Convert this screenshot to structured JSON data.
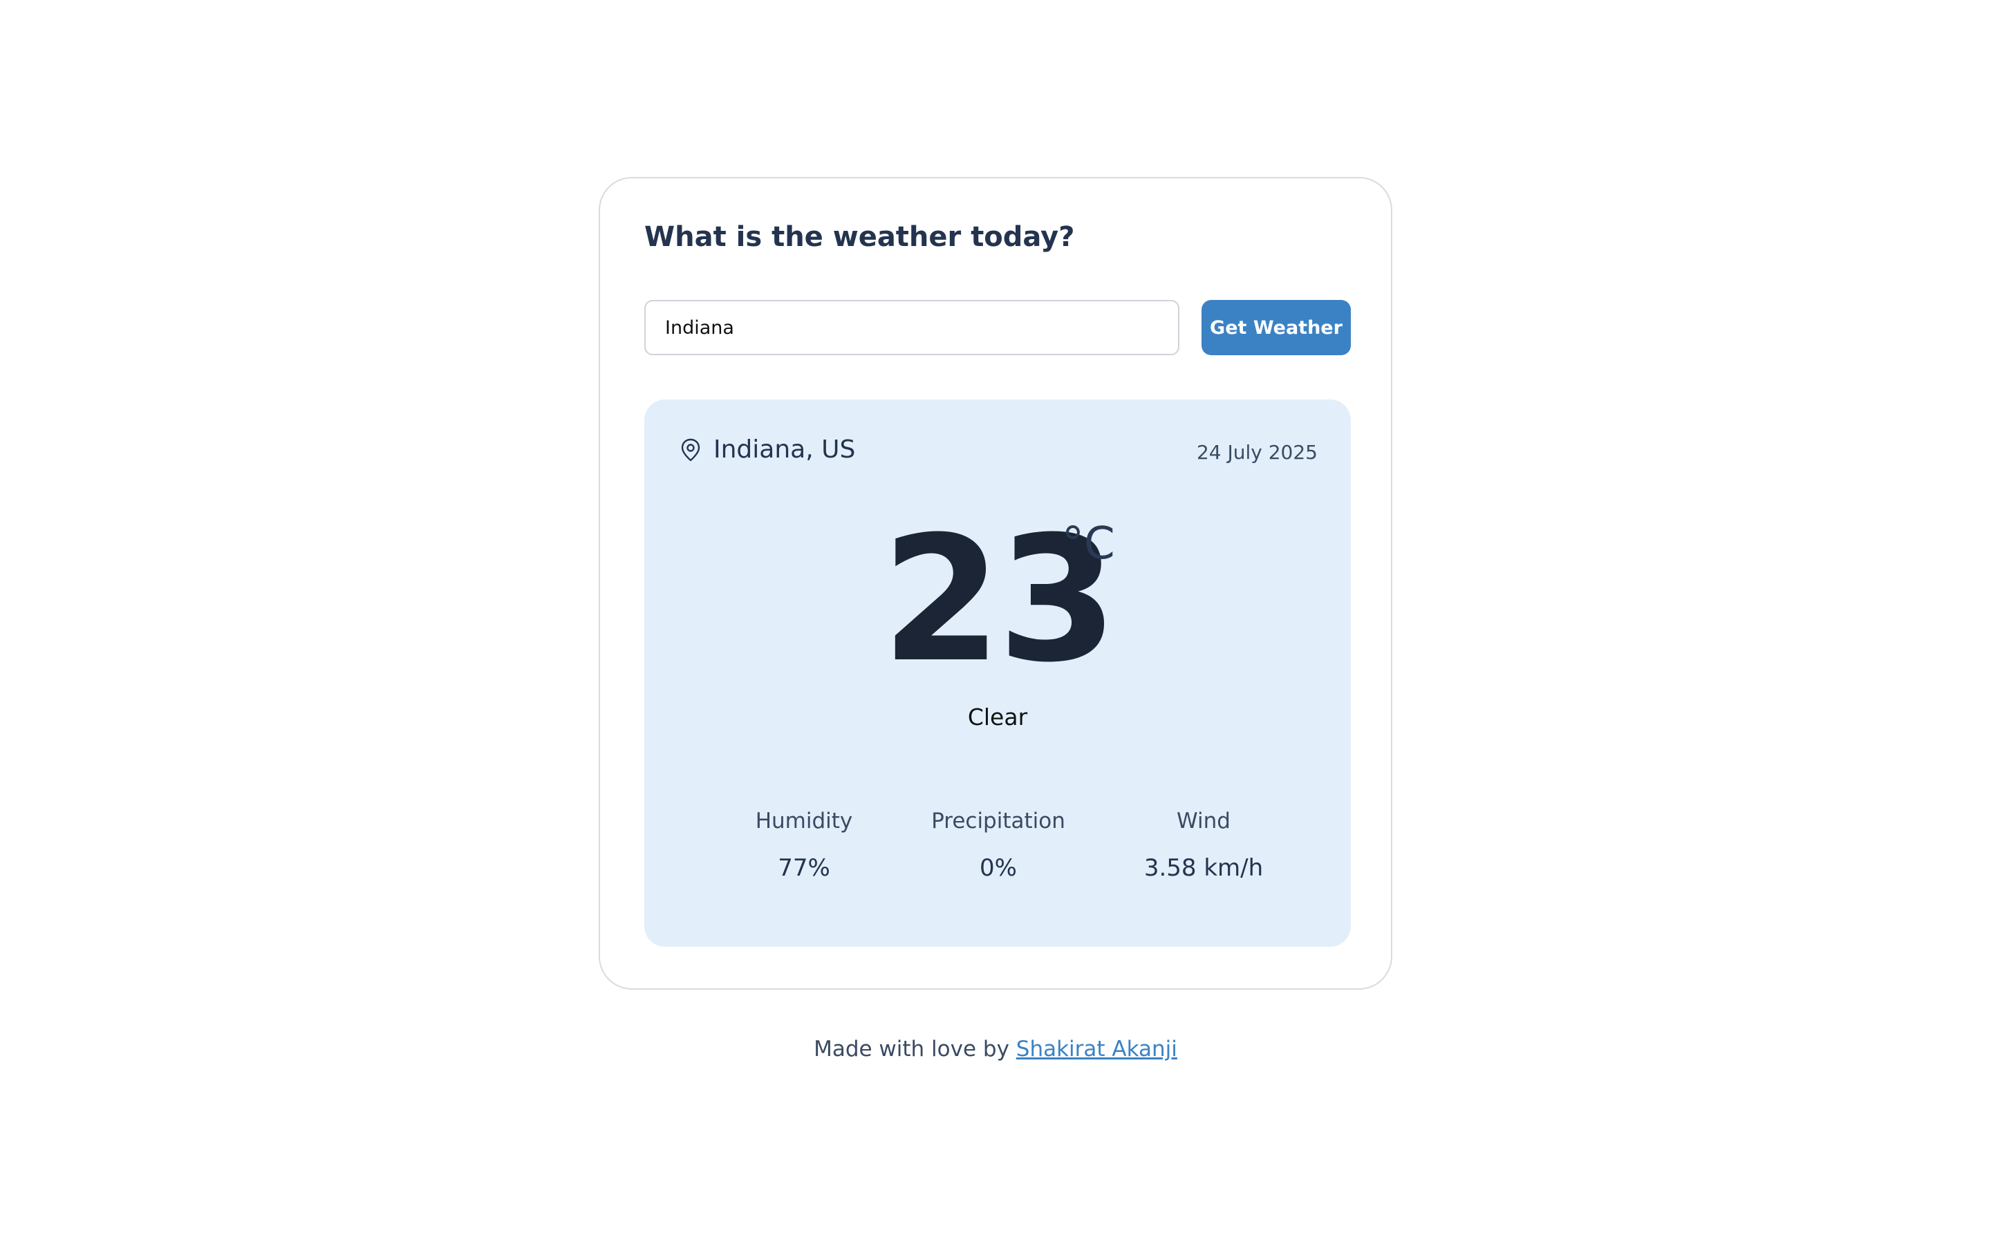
{
  "card": {
    "title": "What is the weather today?"
  },
  "search": {
    "value": "Indiana",
    "button_label": "Get Weather"
  },
  "weather": {
    "location": "Indiana, US",
    "date": "24 July 2025",
    "temperature": "23",
    "unit": "°C",
    "condition": "Clear",
    "stats": [
      {
        "label": "Humidity",
        "value": "77%"
      },
      {
        "label": "Precipitation",
        "value": "0%"
      },
      {
        "label": "Wind",
        "value": "3.58 km/h"
      }
    ]
  },
  "footer": {
    "prefix": "Made with love by ",
    "author": "Shakirat Akanji"
  },
  "colors": {
    "accent": "#3b82c4",
    "panel_background": "#e2effa",
    "title_text": "#24344f"
  },
  "icons": {
    "location": "location-pin-icon"
  }
}
